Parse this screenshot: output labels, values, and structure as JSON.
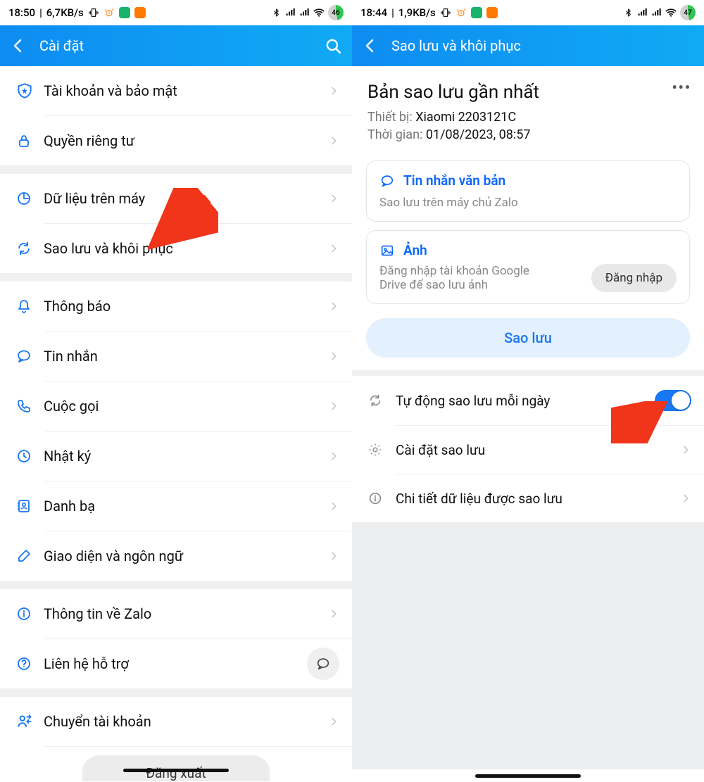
{
  "left": {
    "status": {
      "time": "18:50",
      "net": "6,7KB/s",
      "batt": "46"
    },
    "header": {
      "title": "Cài đặt"
    },
    "groups": [
      {
        "items": [
          {
            "icon": "shield-star",
            "label": "Tài khoản và bảo mật"
          },
          {
            "icon": "lock",
            "label": "Quyền riêng tư"
          }
        ]
      },
      {
        "items": [
          {
            "icon": "pie",
            "label": "Dữ liệu trên máy"
          },
          {
            "icon": "sync",
            "label": "Sao lưu và khôi phục"
          }
        ]
      },
      {
        "items": [
          {
            "icon": "bell",
            "label": "Thông báo"
          },
          {
            "icon": "message",
            "label": "Tin nhắn"
          },
          {
            "icon": "phone",
            "label": "Cuộc gọi"
          },
          {
            "icon": "clock",
            "label": "Nhật ký"
          },
          {
            "icon": "contacts",
            "label": "Danh bạ"
          },
          {
            "icon": "brush",
            "label": "Giao diện và ngôn ngữ"
          }
        ]
      },
      {
        "items": [
          {
            "icon": "info",
            "label": "Thông tin về Zalo"
          },
          {
            "icon": "help",
            "label": "Liên hệ hỗ trợ",
            "trailing": "chat"
          }
        ]
      },
      {
        "items": [
          {
            "icon": "swap-user",
            "label": "Chuyển tài khoản"
          }
        ]
      }
    ],
    "logout": "Đăng xuất"
  },
  "right": {
    "status": {
      "time": "18:44",
      "net": "1,9KB/s",
      "batt": "47"
    },
    "header": {
      "title": "Sao lưu và khôi phục"
    },
    "top": {
      "heading": "Bản sao lưu gần nhất",
      "device_label": "Thiết bị:",
      "device_value": "Xiaomi 2203121C",
      "time_label": "Thời gian:",
      "time_value": "01/08/2023, 08:57"
    },
    "card_msg": {
      "title": "Tin nhắn văn bản",
      "sub": "Sao lưu trên máy chủ Zalo"
    },
    "card_img": {
      "title": "Ảnh",
      "sub": "Đăng nhập tài khoản Google Drive để sao lưu ảnh",
      "btn": "Đăng nhập"
    },
    "backup_btn": "Sao lưu",
    "rows": {
      "auto": "Tự động sao lưu mỗi ngày",
      "setting": "Cài đặt sao lưu",
      "detail": "Chi tiết dữ liệu được sao lưu"
    }
  }
}
